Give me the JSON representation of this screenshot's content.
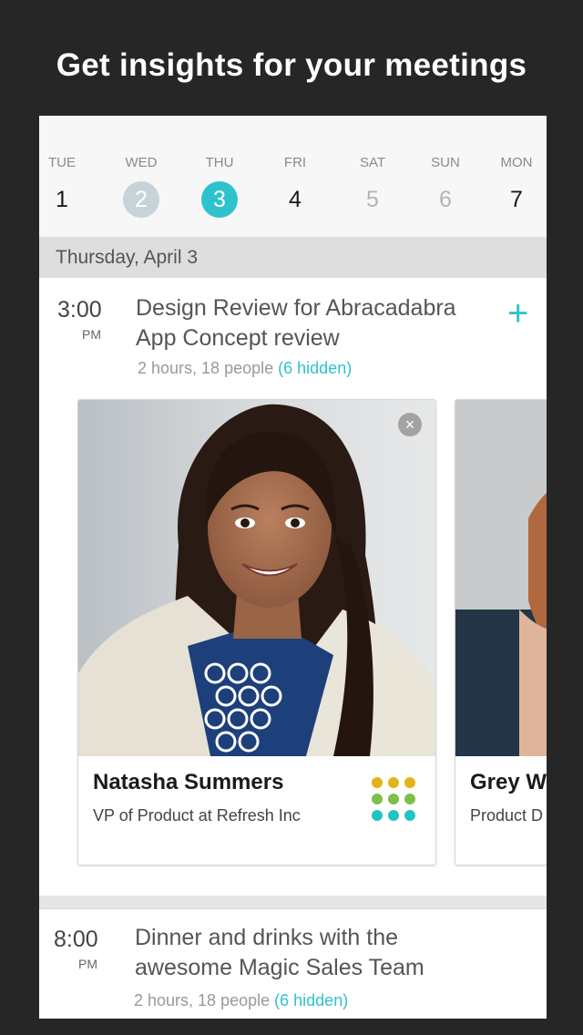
{
  "headline": "Get insights for your meetings",
  "week": [
    {
      "dow": "TUE",
      "num": "1",
      "state": "normal"
    },
    {
      "dow": "WED",
      "num": "2",
      "state": "past"
    },
    {
      "dow": "THU",
      "num": "3",
      "state": "today"
    },
    {
      "dow": "FRI",
      "num": "4",
      "state": "normal"
    },
    {
      "dow": "SAT",
      "num": "5",
      "state": "dim"
    },
    {
      "dow": "SUN",
      "num": "6",
      "state": "dim"
    },
    {
      "dow": "MON",
      "num": "7",
      "state": "normal"
    }
  ],
  "section_date": "Thursday, April 3",
  "events": [
    {
      "time": "3:00",
      "ampm": "PM",
      "title_line1": "Design Review for Abracadabra",
      "title_line2": "App Concept review",
      "meta": "2 hours, 18 people",
      "hidden": "(6 hidden)",
      "add_icon": "+"
    },
    {
      "time": "8:00",
      "ampm": "PM",
      "title_line1": "Dinner and drinks with the",
      "title_line2": "awesome Magic Sales Team",
      "meta": "2 hours, 18 people",
      "hidden": "(6 hidden)"
    }
  ],
  "people": [
    {
      "name": "Natasha Summers",
      "role": "VP of Product at Refresh Inc",
      "close_icon": "×"
    },
    {
      "name": "Grey W",
      "role": "Product D"
    }
  ],
  "colors": {
    "accent": "#2ec3cc",
    "dot_row1": "#e3b418",
    "dot_row2": "#7cbf4a",
    "dot_row3": "#22c3c3"
  }
}
